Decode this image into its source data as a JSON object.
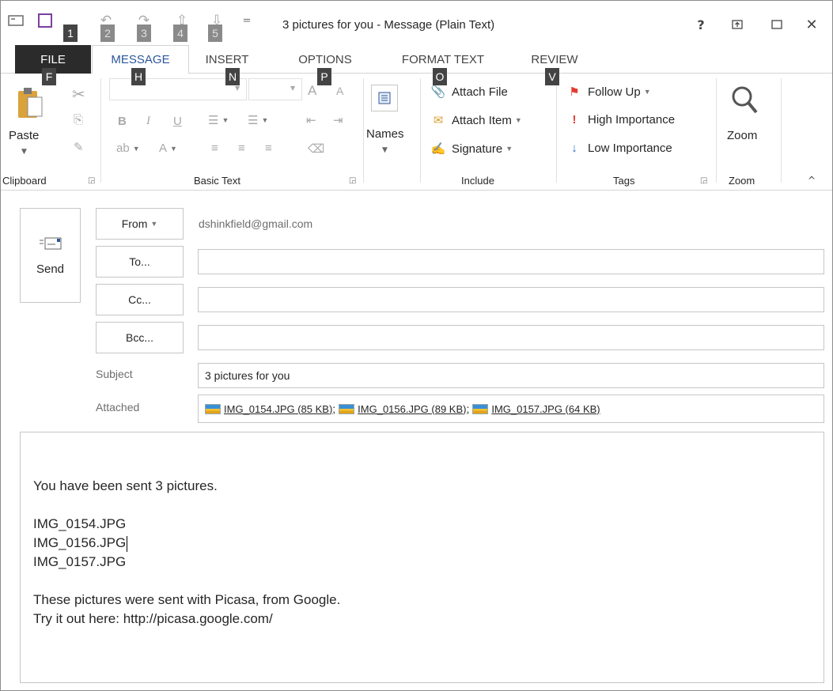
{
  "window": {
    "title": "3 pictures for you - Message (Plain Text)",
    "help": "?",
    "restore": "⊡",
    "maximize": "☐",
    "close": "✕"
  },
  "qat": {
    "keytips": [
      "1",
      "2",
      "3",
      "4",
      "5"
    ],
    "customize": "="
  },
  "tabs": {
    "file": "FILE",
    "items": [
      "MESSAGE",
      "INSERT",
      "OPTIONS",
      "FORMAT TEXT",
      "REVIEW"
    ],
    "active": "MESSAGE",
    "keytips": {
      "file": "F",
      "message": "H",
      "insert": "N",
      "options": "P",
      "format_text": "O",
      "review": "V"
    }
  },
  "ribbon": {
    "clipboard": {
      "paste": "Paste",
      "label": "Clipboard"
    },
    "basic_text": {
      "bold": "B",
      "italic": "I",
      "underline": "U",
      "grow_font": "A",
      "shrink_font": "A",
      "font_color": "A",
      "label": "Basic Text"
    },
    "names": {
      "label": "Names"
    },
    "include": {
      "attach_file": "Attach File",
      "attach_item": "Attach Item",
      "signature": "Signature",
      "label": "Include"
    },
    "tags": {
      "follow_up": "Follow Up",
      "high_importance": "High Importance",
      "low_importance": "Low Importance",
      "label": "Tags"
    },
    "zoom": {
      "button": "Zoom",
      "label": "Zoom"
    },
    "collapse": "^"
  },
  "compose": {
    "send": "Send",
    "from_button": "From",
    "from_address": "dshinkfield@gmail.com",
    "to_button": "To...",
    "cc_button": "Cc...",
    "bcc_button": "Bcc...",
    "to_value": "",
    "cc_value": "",
    "bcc_value": "",
    "subject_label": "Subject",
    "subject_value": "3 pictures for you",
    "attached_label": "Attached",
    "attachments": [
      {
        "name": "IMG_0154.JPG (85 KB)",
        "sep": ";"
      },
      {
        "name": "IMG_0156.JPG (89 KB)",
        "sep": ";"
      },
      {
        "name": "IMG_0157.JPG (64 KB)",
        "sep": ""
      }
    ]
  },
  "body": {
    "lines": [
      "You have been sent 3 pictures.",
      "",
      "IMG_0154.JPG",
      "IMG_0156.JPG",
      "IMG_0157.JPG",
      "",
      "These pictures were sent with Picasa, from Google.",
      "Try it out here: http://picasa.google.com/"
    ]
  },
  "colors": {
    "accent": "#2b579a",
    "file_tab": "#2b2b2b",
    "keytip": "#444444",
    "flag": "#e03c31",
    "importance_high": "#e03c31",
    "importance_low": "#2b6fc2"
  }
}
